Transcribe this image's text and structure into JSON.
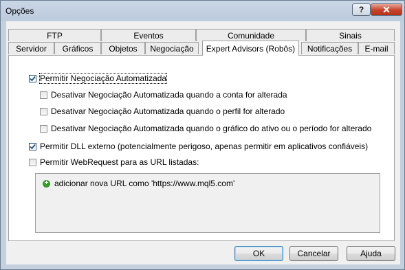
{
  "window": {
    "title": "Opções",
    "help_glyph": "?",
    "close_glyph": "✕"
  },
  "tabs": {
    "back_row": [
      "FTP",
      "Eventos",
      "Comunidade",
      "Sinais"
    ],
    "front_row": [
      "Servidor",
      "Gráficos",
      "Objetos",
      "Negociação",
      "Expert Advisors (Robôs)",
      "Notificações",
      "E-mail"
    ],
    "active": "Expert Advisors (Robôs)"
  },
  "options": {
    "allow_auto_trading": {
      "label": "Permitir Negociação Automatizada",
      "checked": true
    },
    "disable_on_account_change": {
      "label": "Desativar Negociação Automatizada quando a conta for alterada",
      "checked": false
    },
    "disable_on_profile_change": {
      "label": "Desativar Negociação Automatizada quando o perfil for alterado",
      "checked": false
    },
    "disable_on_chart_change": {
      "label": "Desativar Negociação Automatizada quando o gráfico do ativo ou o período for alterado",
      "checked": false
    },
    "allow_dll": {
      "label": "Permitir DLL externo (potencialmente perigoso, apenas permitir em aplicativos confiáveis)",
      "checked": true
    },
    "allow_webrequest": {
      "label": "Permitir WebRequest para as URL listadas:",
      "checked": false
    }
  },
  "url_list": {
    "add_label": "adicionar nova URL como 'https://www.mql5.com'",
    "add_icon": "plus-circle-icon",
    "add_icon_color": "#3a9a2c"
  },
  "buttons": {
    "ok": "OK",
    "cancel": "Cancelar",
    "help": "Ajuda"
  },
  "colors": {
    "title_bar": "#bccbdd",
    "close_button": "#c7432b",
    "checkbox_check": "#1c5180"
  }
}
